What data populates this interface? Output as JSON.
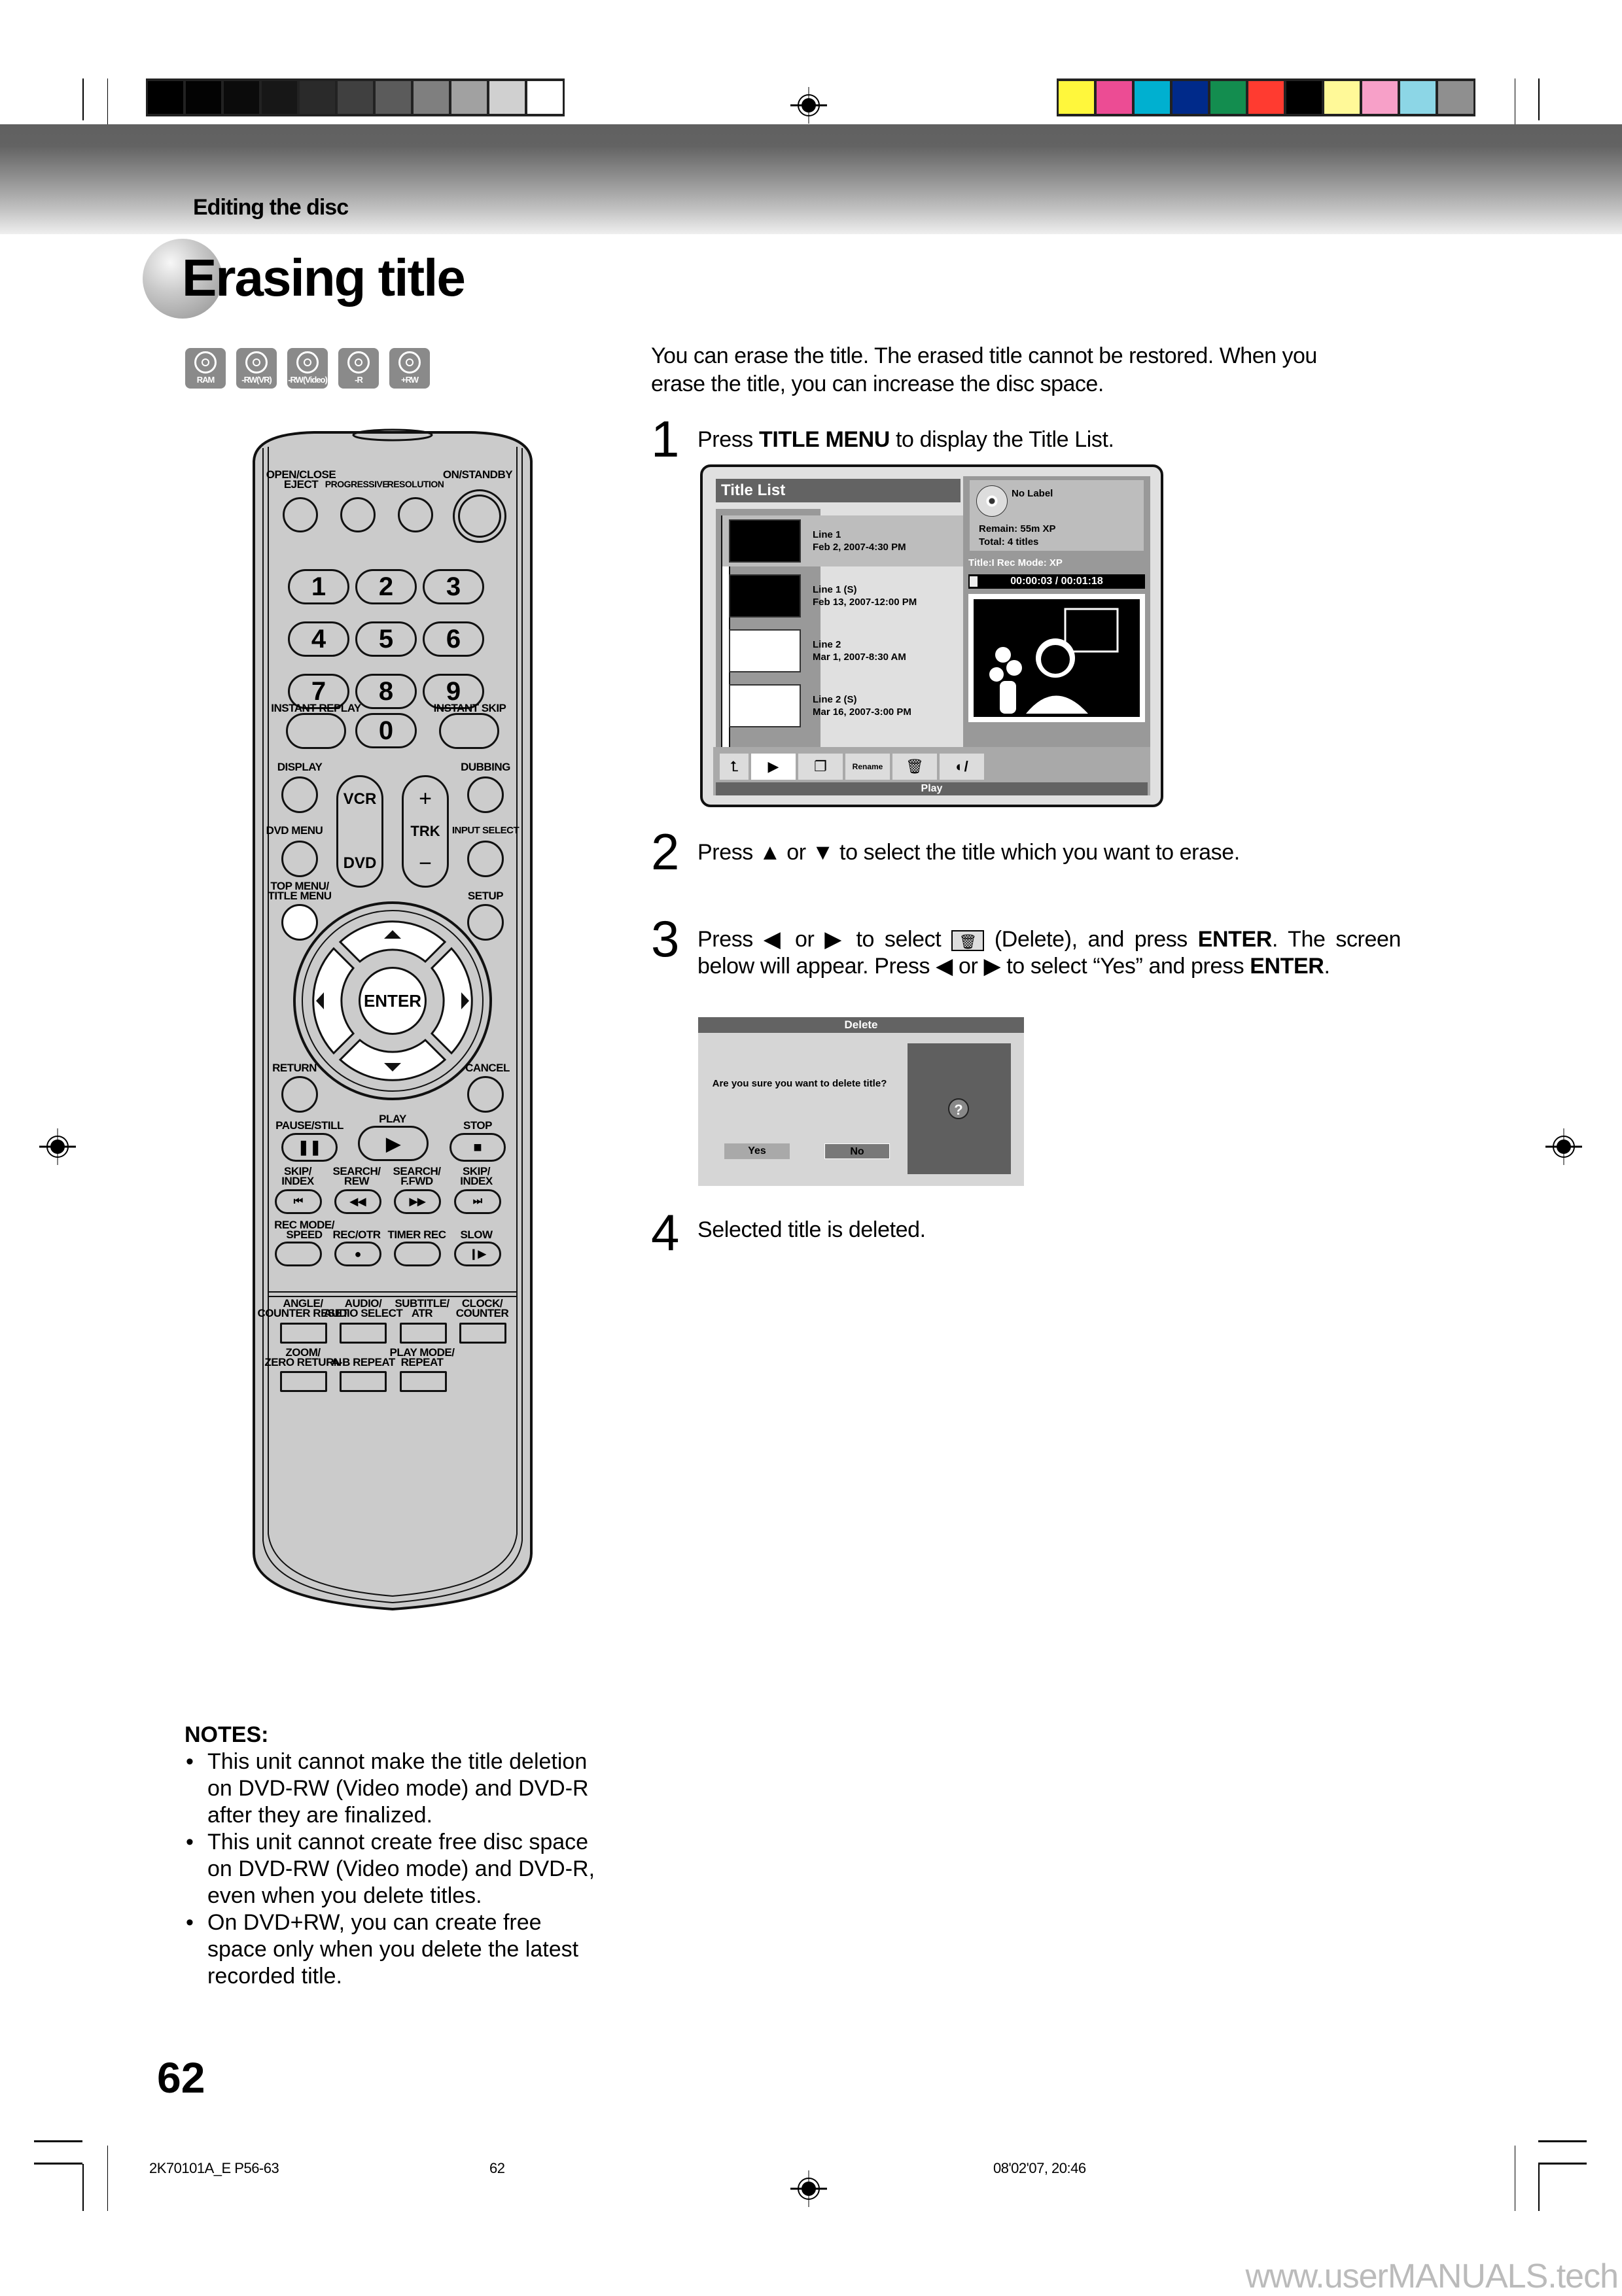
{
  "header": {
    "section": "Editing the disc",
    "title": "Erasing title",
    "grayscale_bar": [
      "#000000",
      "#030303",
      "#0b0b0b",
      "#171717",
      "#2a2a2a",
      "#404040",
      "#5b5b5b",
      "#7f7f7f",
      "#a1a1a1",
      "#d0d0d0",
      "#ffffff"
    ],
    "color_bar": [
      "#fff73c",
      "#ec4c94",
      "#00b0d0",
      "#002a8a",
      "#138d4f",
      "#ff3b30",
      "#000000",
      "#fff998",
      "#f7a0c8",
      "#8cd6e6",
      "#8f8f8f"
    ]
  },
  "disc_types": [
    "RAM",
    "-RW(VR)",
    "-RW(Video)",
    "-R",
    "+RW"
  ],
  "remote": {
    "top_labels": [
      "OPEN/CLOSE\nEJECT",
      "PROGRESSIVE",
      "RESOLUTION",
      "ON/STANDBY"
    ],
    "digits": [
      "1",
      "2",
      "3",
      "4",
      "5",
      "6",
      "7",
      "8",
      "9",
      "0"
    ],
    "instant_replay": "INSTANT REPLAY",
    "instant_skip": "INSTANT SKIP",
    "display": "DISPLAY",
    "dubbing": "DUBBING",
    "dvd_menu": "DVD MENU",
    "input_select": "INPUT SELECT",
    "top_menu": "TOP MENU/\nTITLE MENU",
    "setup": "SETUP",
    "vcr": "VCR",
    "dvd": "DVD",
    "trk": "TRK",
    "trk_plus": "+",
    "trk_minus": "−",
    "enter": "ENTER",
    "return": "RETURN",
    "cancel": "CANCEL",
    "pause": "PAUSE/STILL",
    "play": "PLAY",
    "stop": "STOP",
    "skip_back": "SKIP/\nINDEX",
    "search_rew": "SEARCH/\nREW",
    "search_ffwd": "SEARCH/\nF.FWD",
    "skip_fwd": "SKIP/\nINDEX",
    "rec_mode": "REC MODE/\nSPEED",
    "rec_otr": "REC/OTR",
    "timer_rec": "TIMER REC",
    "slow": "SLOW",
    "angle": "ANGLE/\nCOUNTER RESET",
    "audio": "AUDIO/\nAUDIO SELECT",
    "subtitle": "SUBTITLE/\nATR",
    "clock": "CLOCK/\nCOUNTER",
    "zoom": "ZOOM/\nZERO RETURN",
    "ab_repeat": "A-B REPEAT",
    "play_mode": "PLAY MODE/\nREPEAT"
  },
  "intro": "You can erase the title. The erased title cannot be restored. When you erase the title, you can increase the disc space.",
  "steps": [
    {
      "num": "1",
      "pre": "Press ",
      "bold": "TITLE MENU",
      "post": " to display the Title List."
    },
    {
      "num": "2",
      "text": "Press ▲ or ▼ to select the title which you want to erase."
    },
    {
      "num": "3",
      "pre": "Press ◀ or ▶ to select ",
      "mid": " (Delete), and press ",
      "bold": "ENTER",
      "post": ". The screen below will appear. Press ◀ or ▶ to select “Yes” and press ",
      "bold2": "ENTER",
      "end": "."
    },
    {
      "num": "4",
      "text": "Selected title is deleted."
    }
  ],
  "title_list": {
    "header": "Title List",
    "titles": [
      {
        "name": "Line 1",
        "date": "Feb 2, 2007-4:30 PM",
        "selected": true
      },
      {
        "name": "Line 1 (S)",
        "date": "Feb 13, 2007-12:00 PM",
        "selected": false
      },
      {
        "name": "Line 2",
        "date": "Mar 1, 2007-8:30 AM",
        "selected": false
      },
      {
        "name": "Line 2 (S)",
        "date": "Mar 16, 2007-3:00 PM",
        "selected": false
      }
    ],
    "disc_label": "No Label",
    "remain": "Remain: 55m  XP",
    "total": "Total: 4 titles",
    "title_info": "Title:I  Rec Mode: XP",
    "time": "00:00:03  /  00:01:18",
    "tools": [
      "return-icon",
      "play-icon",
      "copy-icon",
      "Rename",
      "delete-icon",
      "edit-disc-icon"
    ],
    "rename_label": "Rename",
    "status": "Play"
  },
  "delete_dialog": {
    "title": "Delete",
    "message": "Are you sure you want to delete title?",
    "yes": "Yes",
    "no": "No",
    "icon": "?"
  },
  "notes": {
    "heading": "NOTES:",
    "items": [
      "This unit cannot make the title deletion on DVD-RW (Video mode) and DVD-R after they are finalized.",
      "This unit cannot create free disc space on DVD-RW (Video mode) and DVD-R, even when you delete titles.",
      "On DVD+RW, you can create free space only when you delete the latest recorded title."
    ]
  },
  "page_number": "62",
  "footer": {
    "file": "2K70101A_E P56-63",
    "page": "62",
    "date": "08'02'07, 20:46"
  },
  "watermark": "www.userMANUALS.tech"
}
